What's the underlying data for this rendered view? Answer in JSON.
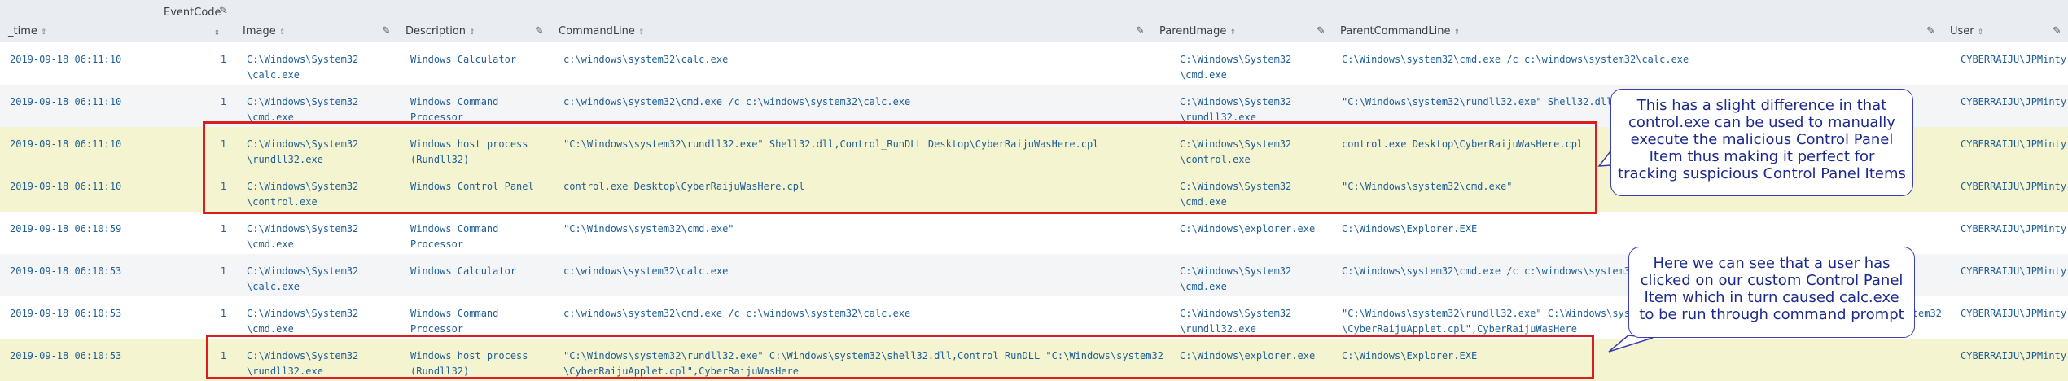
{
  "columns": [
    {
      "key": "time",
      "label": "_time",
      "sort": "⇕",
      "edit": false
    },
    {
      "key": "eventcode",
      "label": "EventCode",
      "sort": "⇕",
      "edit": true
    },
    {
      "key": "image",
      "label": "Image",
      "sort": "⇕",
      "edit": true
    },
    {
      "key": "description",
      "label": "Description",
      "sort": "⇕",
      "edit": true
    },
    {
      "key": "commandline",
      "label": "CommandLine",
      "sort": "⇕",
      "edit": true
    },
    {
      "key": "parentimage",
      "label": "ParentImage",
      "sort": "⇕",
      "edit": true
    },
    {
      "key": "parentcommandline",
      "label": "ParentCommandLine",
      "sort": "⇕",
      "edit": true
    },
    {
      "key": "user",
      "label": "User",
      "sort": "⇕",
      "edit": true
    }
  ],
  "rows": [
    {
      "time": "2019-09-18 06:11:10",
      "eventcode": "1",
      "image": [
        "C:\\Windows\\System32",
        "\\calc.exe"
      ],
      "description": [
        "Windows Calculator"
      ],
      "commandline": [
        "c:\\windows\\system32\\calc.exe"
      ],
      "parentimage": [
        "C:\\Windows\\System32",
        "\\cmd.exe"
      ],
      "parentcommandline": [
        "C:\\Windows\\system32\\cmd.exe /c c:\\windows\\system32\\calc.exe"
      ],
      "user": "CYBERRAIJU\\JPMinty"
    },
    {
      "time": "2019-09-18 06:11:10",
      "eventcode": "1",
      "image": [
        "C:\\Windows\\System32",
        "\\cmd.exe"
      ],
      "description": [
        "Windows Command",
        "Processor"
      ],
      "commandline": [
        "c:\\windows\\system32\\cmd.exe /c c:\\windows\\system32\\calc.exe"
      ],
      "parentimage": [
        "C:\\Windows\\System32",
        "\\rundll32.exe"
      ],
      "parentcommandline": [
        "\"C:\\Windows\\system32\\rundll32.exe\" Shell32.dll,"
      ],
      "user": "CYBERRAIJU\\JPMinty"
    },
    {
      "time": "2019-09-18 06:11:10",
      "eventcode": "1",
      "image": [
        "C:\\Windows\\System32",
        "\\rundll32.exe"
      ],
      "description": [
        "Windows host process",
        "(Rundll32)"
      ],
      "commandline": [
        "\"C:\\Windows\\system32\\rundll32.exe\" Shell32.dll,Control_RunDLL Desktop\\CyberRaijuWasHere.cpl"
      ],
      "parentimage": [
        "C:\\Windows\\System32",
        "\\control.exe"
      ],
      "parentcommandline": [
        "control.exe  Desktop\\CyberRaijuWasHere.cpl"
      ],
      "user": "CYBERRAIJU\\JPMinty"
    },
    {
      "time": "2019-09-18 06:11:10",
      "eventcode": "1",
      "image": [
        "C:\\Windows\\System32",
        "\\control.exe"
      ],
      "description": [
        "Windows Control Panel"
      ],
      "commandline": [
        "control.exe  Desktop\\CyberRaijuWasHere.cpl"
      ],
      "parentimage": [
        "C:\\Windows\\System32",
        "\\cmd.exe"
      ],
      "parentcommandline": [
        "\"C:\\Windows\\system32\\cmd.exe\""
      ],
      "user": "CYBERRAIJU\\JPMinty"
    },
    {
      "time": "2019-09-18 06:10:59",
      "eventcode": "1",
      "image": [
        "C:\\Windows\\System32",
        "\\cmd.exe"
      ],
      "description": [
        "Windows Command",
        "Processor"
      ],
      "commandline": [
        "\"C:\\Windows\\system32\\cmd.exe\""
      ],
      "parentimage": [
        "C:\\Windows\\explorer.exe"
      ],
      "parentcommandline": [
        "C:\\Windows\\Explorer.EXE"
      ],
      "user": "CYBERRAIJU\\JPMinty"
    },
    {
      "time": "2019-09-18 06:10:53",
      "eventcode": "1",
      "image": [
        "C:\\Windows\\System32",
        "\\calc.exe"
      ],
      "description": [
        "Windows Calculator"
      ],
      "commandline": [
        "c:\\windows\\system32\\calc.exe"
      ],
      "parentimage": [
        "C:\\Windows\\System32",
        "\\cmd.exe"
      ],
      "parentcommandline": [
        "C:\\Windows\\system32\\cmd.exe /c c:\\windows\\system32\\calc.exe"
      ],
      "user": "CYBERRAIJU\\JPMinty"
    },
    {
      "time": "2019-09-18 06:10:53",
      "eventcode": "1",
      "image": [
        "C:\\Windows\\System32",
        "\\cmd.exe"
      ],
      "description": [
        "Windows Command",
        "Processor"
      ],
      "commandline": [
        "c:\\windows\\system32\\cmd.exe /c c:\\windows\\system32\\calc.exe"
      ],
      "parentimage": [
        "C:\\Windows\\System32",
        "\\rundll32.exe"
      ],
      "parentcommandline": [
        "\"C:\\Windows\\system32\\rundll32.exe\" C:\\Windows\\system32\\shell32.dll,Control_RunDLL \"C:\\Windows\\system32",
        "\\CyberRaijuApplet.cpl\",CyberRaijuWasHere"
      ],
      "user": "CYBERRAIJU\\JPMinty"
    },
    {
      "time": "2019-09-18 06:10:53",
      "eventcode": "1",
      "image": [
        "C:\\Windows\\System32",
        "\\rundll32.exe"
      ],
      "description": [
        "Windows host process",
        "(Rundll32)"
      ],
      "commandline": [
        "\"C:\\Windows\\system32\\rundll32.exe\" C:\\Windows\\system32\\shell32.dll,Control_RunDLL \"C:\\Windows\\system32",
        "\\CyberRaijuApplet.cpl\",CyberRaijuWasHere"
      ],
      "parentimage": [
        "C:\\Windows\\explorer.exe"
      ],
      "parentcommandline": [
        "C:\\Windows\\Explorer.EXE"
      ],
      "user": "CYBERRAIJU\\JPMinty"
    }
  ],
  "callouts": [
    {
      "id": "callout-control-exe",
      "text": "This has a slight difference in that control.exe can be used to manually execute the malicious Control Panel Item thus making it perfect for tracking suspicious Control Panel Items"
    },
    {
      "id": "callout-user-clicked",
      "text": "Here we can see that a user has clicked on our custom Control Panel Item which in turn caused calc.exe to be run through command prompt"
    }
  ],
  "colors": {
    "header_bg": "#e9edf1",
    "alt_row_bg": "#f4f5f6",
    "highlight_bg": "#f4f5d0",
    "link_text": "#1f5e96",
    "redbox": "#d81e1e",
    "callout_text": "#1c2a8c",
    "callout_border": "#3b3fa8"
  },
  "icons": {
    "sort": "sort-arrows-icon",
    "edit": "pencil-icon"
  }
}
